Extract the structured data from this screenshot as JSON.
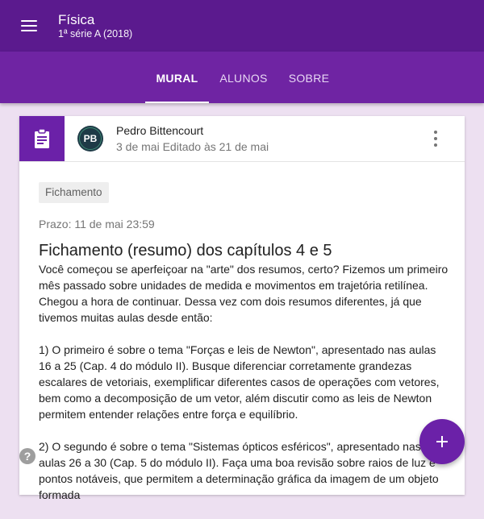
{
  "header": {
    "title": "Física",
    "subtitle": "1ª série A (2018)",
    "menu_icon": "hamburger-menu-icon"
  },
  "tabs": [
    {
      "label": "MURAL",
      "active": true
    },
    {
      "label": "ALUNOS",
      "active": false
    },
    {
      "label": "SOBRE",
      "active": false
    }
  ],
  "post": {
    "type_icon": "assignment-clipboard-icon",
    "avatar_text": "PB",
    "author": "Pedro Bittencourt",
    "dates": "3 de mai Editado às 21 de mai",
    "more_icon": "more-vert-icon",
    "tag": "Fichamento",
    "due": "Prazo: 11 de mai 23:59",
    "title": "Fichamento (resumo) dos capítulos 4 e 5",
    "body": [
      "Você começou se aperfeiçoar na \"arte\" dos resumos, certo? Fizemos um primeiro mês passado sobre unidades de medida e movimentos em trajetória retilínea. Chegou a hora de continuar. Dessa vez com dois resumos diferentes, já que tivemos muitas aulas desde então:",
      "1) O primeiro é sobre o tema \"Forças e leis de Newton\", apresentado nas aulas 16 a 25 (Cap. 4 do módulo II). Busque diferenciar corretamente grandezas escalares de vetoriais, exemplificar diferentes casos de operações com vetores, bem como a decomposição de um vetor, além discutir como as leis de Newton permitem entender relações entre força e equilíbrio.",
      "2) O segundo é sobre o tema \"Sistemas ópticos esféricos\", apresentado nas aulas 26 a 30 (Cap. 5 do módulo II). Faça uma boa revisão sobre raios de luz e pontos notáveis, que permitem a determinação gráfica da imagem de um objeto formada"
    ]
  },
  "help_icon": "help-icon",
  "fab_icon": "add-icon",
  "colors": {
    "appbar": "#5b1a8e",
    "tabbar": "#6f24a3",
    "accent": "#6b21a8",
    "page_bg": "#ede0f1"
  }
}
